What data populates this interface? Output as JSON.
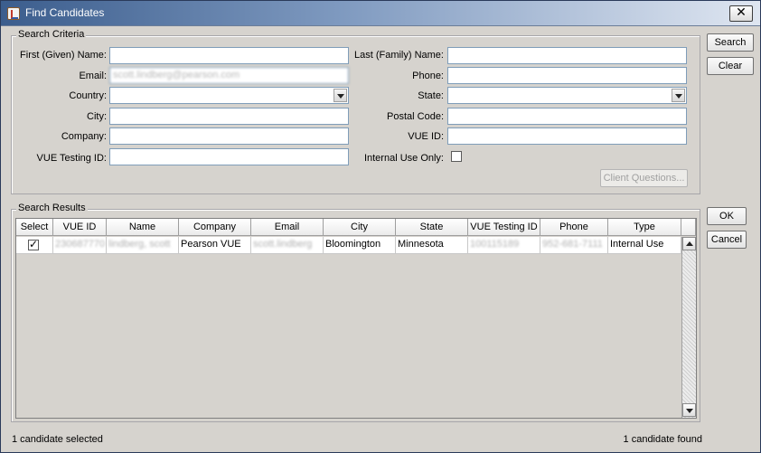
{
  "window": {
    "title": "Find Candidates",
    "close_label": "✕"
  },
  "criteria": {
    "group_title": "Search Criteria",
    "first_name_label": "First (Given) Name:",
    "first_name_value": "",
    "last_name_label": "Last (Family) Name:",
    "last_name_value": "",
    "email_label": "Email:",
    "email_value": "scott.lindberg@pearson.com",
    "phone_label": "Phone:",
    "phone_value": "",
    "country_label": "Country:",
    "country_value": "",
    "state_label": "State:",
    "state_value": "",
    "city_label": "City:",
    "city_value": "",
    "postal_label": "Postal Code:",
    "postal_value": "",
    "company_label": "Company:",
    "company_value": "",
    "vue_id_label": "VUE ID:",
    "vue_id_value": "",
    "vue_testing_label": "VUE Testing ID:",
    "vue_testing_value": "",
    "internal_use_label": "Internal Use Only:",
    "internal_use_checked": false,
    "client_questions_label": "Client Questions..."
  },
  "actions": {
    "search_label": "Search",
    "clear_label": "Clear",
    "ok_label": "OK",
    "cancel_label": "Cancel"
  },
  "results": {
    "group_title": "Search Results",
    "columns": [
      "Select",
      "VUE ID",
      "Name",
      "Company",
      "Email",
      "City",
      "State",
      "VUE Testing ID",
      "Phone",
      "Type"
    ],
    "rows": [
      {
        "selected": true,
        "vue_id": "230687770",
        "name": "lindberg, scott",
        "company": "Pearson VUE",
        "email": "scott.lindberg",
        "city": "Bloomington",
        "state": "Minnesota",
        "vue_testing_id": "100115189",
        "phone": "952-681-7111",
        "type": "Internal Use"
      }
    ]
  },
  "status": {
    "selected_text": "1 candidate selected",
    "found_text": "1 candidate found"
  }
}
